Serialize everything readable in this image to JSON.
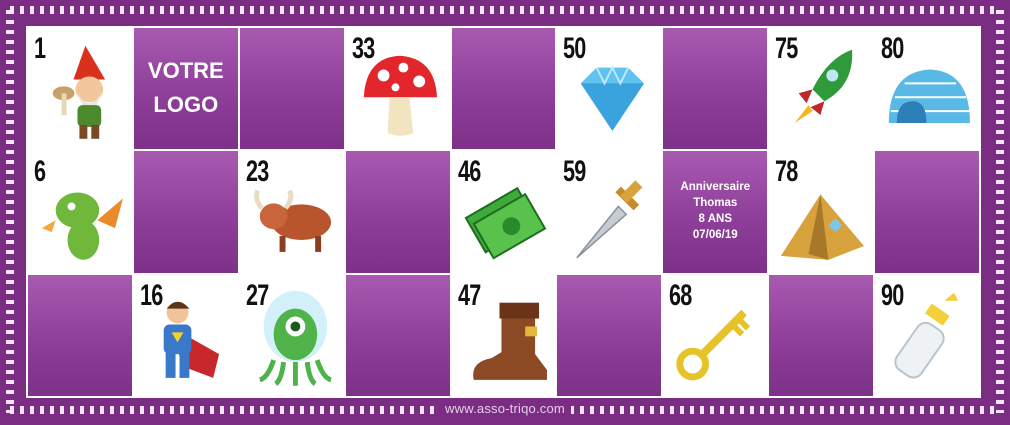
{
  "card": {
    "logo_line1": "VOTRE",
    "logo_line2": "LOGO",
    "event_line1": "Anniversaire",
    "event_line2": "Thomas",
    "event_line3": "8 ANS",
    "event_line4": "07/06/19",
    "footer": "www.asso-triqo.com"
  },
  "cells": [
    {
      "row": 1,
      "col": 1,
      "number": "1",
      "icon": "gnome-icon"
    },
    {
      "row": 1,
      "col": 2,
      "logo": true
    },
    {
      "row": 1,
      "col": 3,
      "empty": true
    },
    {
      "row": 1,
      "col": 4,
      "number": "33",
      "icon": "mushroom-icon"
    },
    {
      "row": 1,
      "col": 5,
      "empty": true
    },
    {
      "row": 1,
      "col": 6,
      "number": "50",
      "icon": "diamond-icon"
    },
    {
      "row": 1,
      "col": 7,
      "empty": true
    },
    {
      "row": 1,
      "col": 8,
      "number": "75",
      "icon": "rocket-icon"
    },
    {
      "row": 1,
      "col": 9,
      "number": "80",
      "icon": "igloo-icon"
    },
    {
      "row": 2,
      "col": 1,
      "number": "6",
      "icon": "dragon-icon"
    },
    {
      "row": 2,
      "col": 2,
      "empty": true
    },
    {
      "row": 2,
      "col": 3,
      "number": "23",
      "icon": "bull-icon"
    },
    {
      "row": 2,
      "col": 4,
      "empty": true
    },
    {
      "row": 2,
      "col": 5,
      "number": "46",
      "icon": "money-icon"
    },
    {
      "row": 2,
      "col": 6,
      "number": "59",
      "icon": "sword-icon"
    },
    {
      "row": 2,
      "col": 7,
      "event": true
    },
    {
      "row": 2,
      "col": 8,
      "number": "78",
      "icon": "tent-icon"
    },
    {
      "row": 2,
      "col": 9,
      "empty": true
    },
    {
      "row": 3,
      "col": 1,
      "empty": true
    },
    {
      "row": 3,
      "col": 2,
      "number": "16",
      "icon": "superhero-icon"
    },
    {
      "row": 3,
      "col": 3,
      "number": "27",
      "icon": "alien-icon"
    },
    {
      "row": 3,
      "col": 4,
      "empty": true
    },
    {
      "row": 3,
      "col": 5,
      "number": "47",
      "icon": "boot-icon"
    },
    {
      "row": 3,
      "col": 6,
      "empty": true
    },
    {
      "row": 3,
      "col": 7,
      "number": "68",
      "icon": "key-icon"
    },
    {
      "row": 3,
      "col": 8,
      "empty": true
    },
    {
      "row": 3,
      "col": 9,
      "number": "90",
      "icon": "baby-bottle-icon"
    }
  ],
  "colors": {
    "frame": "#7b2d84",
    "cell_empty": "#9a4aa5",
    "cell_number": "#ffffff"
  }
}
